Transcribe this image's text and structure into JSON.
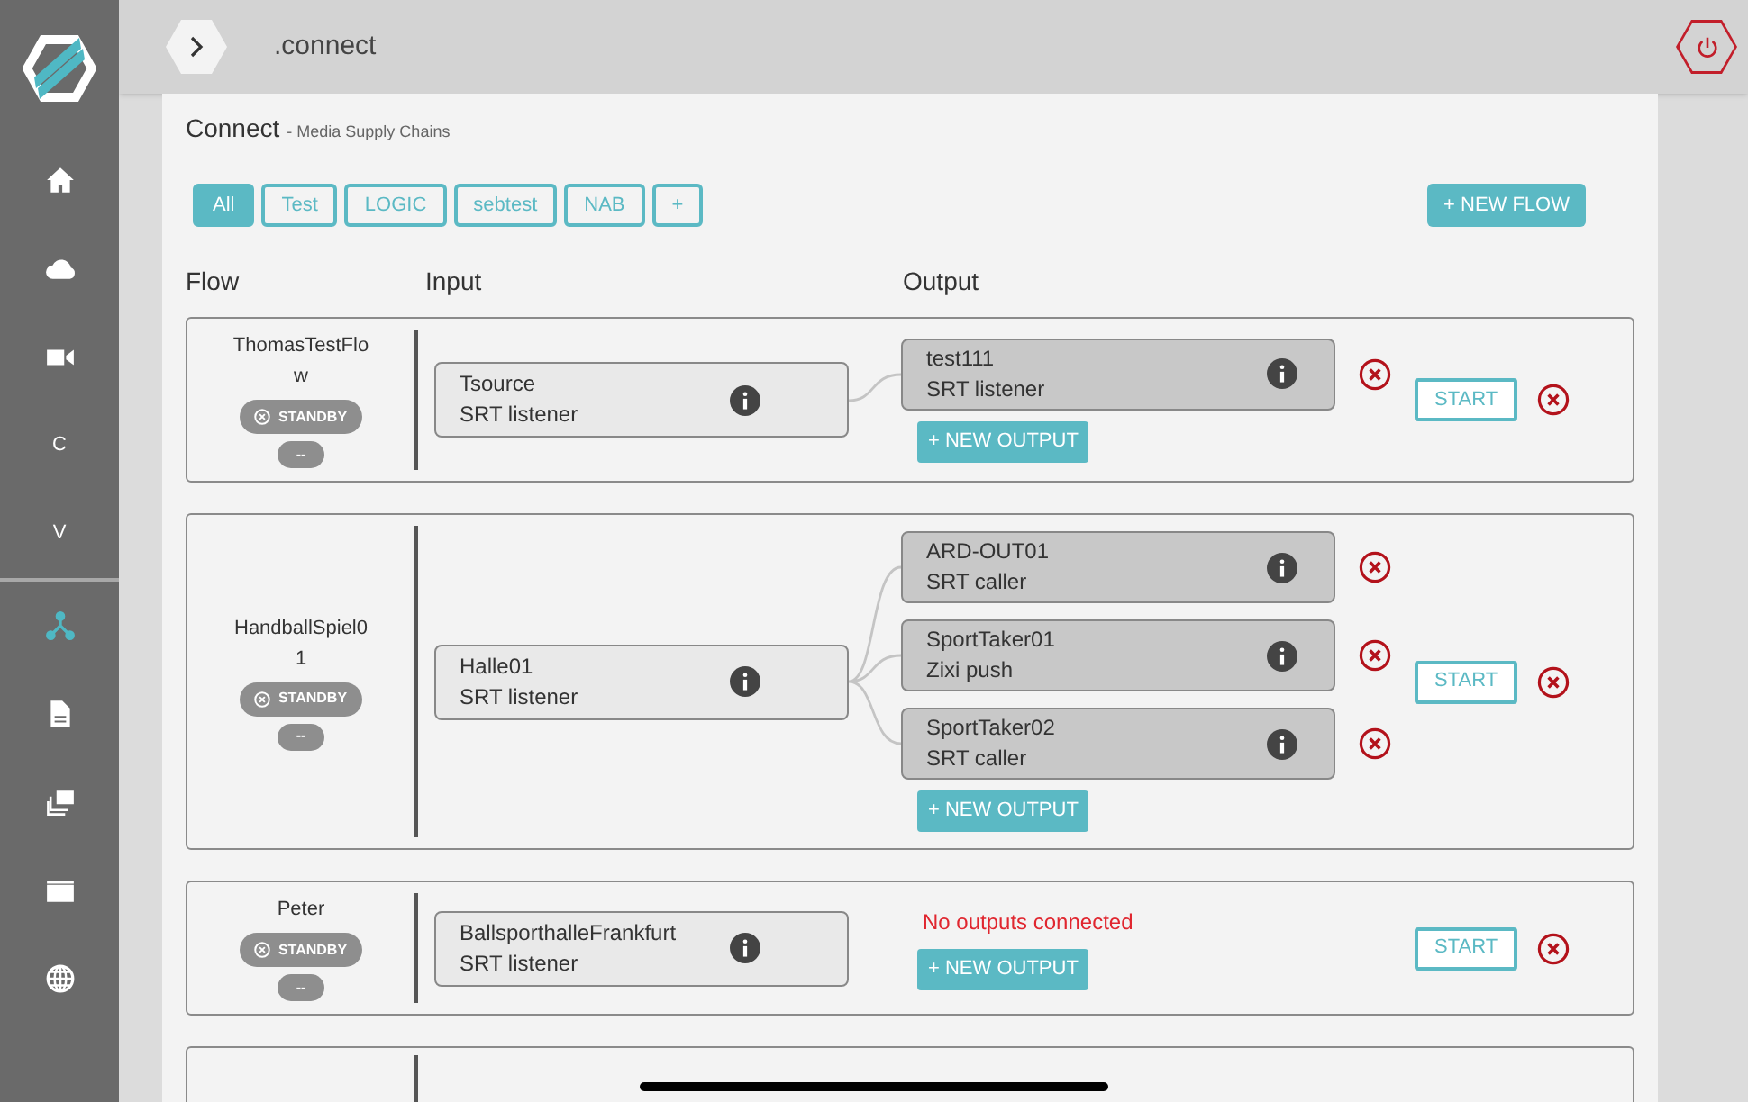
{
  "app_bar": {
    "title": ".connect"
  },
  "sidebar": {
    "items": [
      {
        "kind": "home",
        "selected": false
      },
      {
        "kind": "cloud",
        "selected": false
      },
      {
        "kind": "camera",
        "selected": false
      },
      {
        "kind": "letter",
        "label": "C",
        "selected": false
      },
      {
        "kind": "letter",
        "label": "V",
        "selected": false
      },
      {
        "kind": "network",
        "selected": true
      },
      {
        "kind": "document",
        "selected": false
      },
      {
        "kind": "layers",
        "selected": false
      },
      {
        "kind": "clapper",
        "selected": false
      },
      {
        "kind": "globe",
        "selected": false
      }
    ]
  },
  "page": {
    "title": "Connect",
    "subtitle": "- Media Supply Chains"
  },
  "filters": [
    {
      "label": "All",
      "selected": true
    },
    {
      "label": "Test",
      "selected": false
    },
    {
      "label": "LOGIC",
      "selected": false
    },
    {
      "label": "sebtest",
      "selected": false
    },
    {
      "label": "NAB",
      "selected": false
    },
    {
      "label": "+",
      "selected": false
    }
  ],
  "new_flow_button": "+ NEW FLOW",
  "columns": [
    "Flow",
    "Input",
    "Output"
  ],
  "flows": [
    {
      "name": "ThomasTestFlow",
      "status": "STANDBY",
      "extra": "--",
      "input": {
        "name": "Tsource",
        "type": "SRT listener"
      },
      "outputs": [
        {
          "name": "test111",
          "type": "SRT listener"
        }
      ],
      "new_output": "+ NEW OUTPUT",
      "start": "START"
    },
    {
      "name": "HandballSpiel01",
      "status": "STANDBY",
      "extra": "--",
      "input": {
        "name": "Halle01",
        "type": "SRT listener"
      },
      "outputs": [
        {
          "name": "ARD-OUT01",
          "type": "SRT caller"
        },
        {
          "name": "SportTaker01",
          "type": "Zixi push"
        },
        {
          "name": "SportTaker02",
          "type": "SRT caller"
        }
      ],
      "new_output": "+ NEW OUTPUT",
      "start": "START"
    },
    {
      "name": "Peter",
      "status": "STANDBY",
      "extra": "--",
      "input": {
        "name": "BallsporthalleFrankfurt",
        "type": "SRT listener"
      },
      "empty_message": "No outputs connected",
      "new_output": "+ NEW OUTPUT",
      "start": "START"
    }
  ]
}
